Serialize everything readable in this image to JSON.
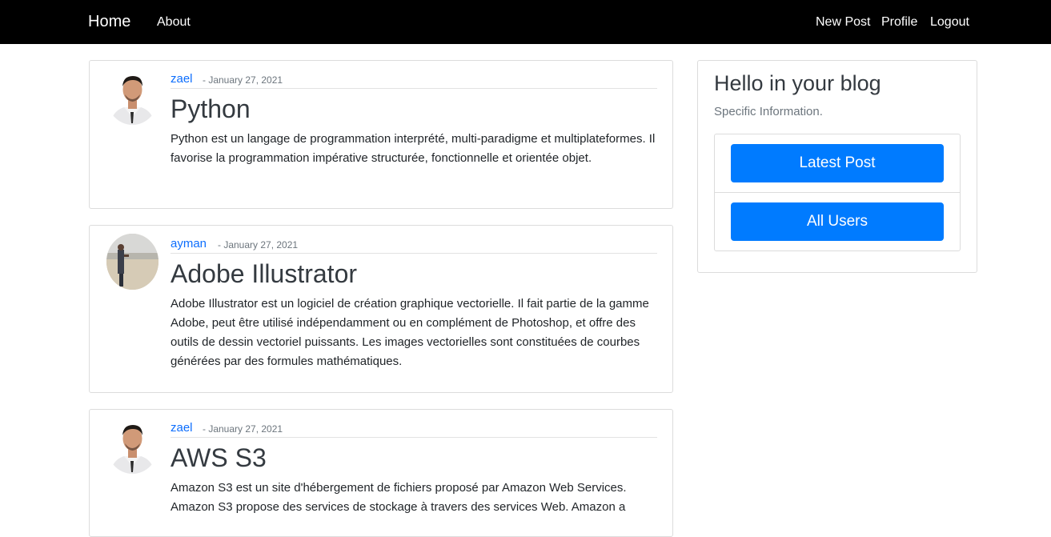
{
  "navbar": {
    "home_label": "Home",
    "about_label": "About",
    "new_post_label": "New Post",
    "profile_label": "Profile",
    "logout_label": "Logout",
    "background": "#000000"
  },
  "posts": [
    {
      "author": "zael",
      "date": "- January 27, 2021",
      "title": "Python",
      "content": "Python est un langage de programmation interprété, multi-paradigme et multiplateformes. Il favorise la programmation impérative structurée, fonctionnelle et orientée objet.",
      "avatar": "profile-photo-man-suit"
    },
    {
      "author": "ayman",
      "date": "- January 27, 2021",
      "title": "Adobe Illustrator",
      "content": "Adobe Illustrator est un logiciel de création graphique vectorielle. Il fait partie de la gamme Adobe, peut être utilisé indépendamment ou en complément de Photoshop, et offre des outils de dessin vectoriel puissants. Les images vectorielles sont constituées de courbes générées par des formules mathématiques.",
      "avatar": "profile-photo-beach"
    },
    {
      "author": "zael",
      "date": "- January 27, 2021",
      "title": "AWS S3",
      "content": "Amazon S3 est un site d'hébergement de fichiers proposé par Amazon Web Services. Amazon S3 propose des services de stockage à travers des services Web. Amazon a",
      "avatar": "profile-photo-man-suit"
    }
  ],
  "sidebar": {
    "title": "Hello in your blog",
    "subtitle": "Specific Information.",
    "latest_post_label": "Latest Post",
    "all_users_label": "All Users",
    "button_color": "#007bff"
  },
  "colors": {
    "link": "#0d6efd",
    "muted": "#6c757d",
    "heading": "#343a40"
  }
}
